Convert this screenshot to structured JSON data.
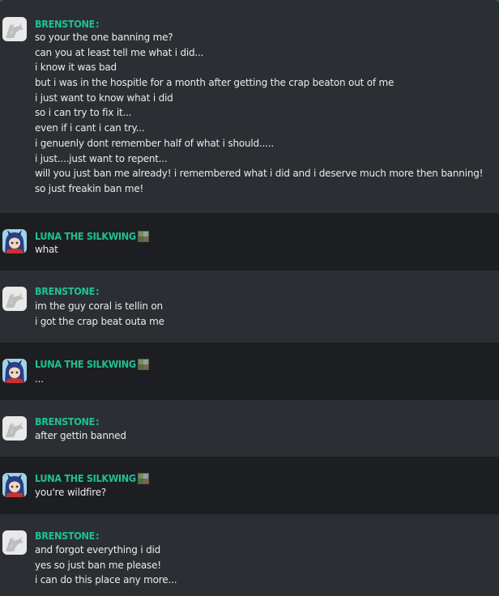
{
  "messages": [
    {
      "author": "BRENSTONE",
      "colon": ":",
      "lines": [
        "so your the one banning me?",
        "can you at least tell me what i did...",
        "i know it was bad",
        "but i was in the hospitle for a month after getting the crap beaton out of me",
        "i just want to know what i did",
        "so i can try to fix it...",
        "even if i cant i can try...",
        "i genuenly dont remember half of what i should.....",
        "i just....just want to repent...",
        "will you just ban me already! i remembered what i did and i deserve much more then banning!",
        "so just freakin ban me!"
      ]
    },
    {
      "author": "LUNA THE SILKWING",
      "lines": [
        "what"
      ]
    },
    {
      "author": "BRENSTONE",
      "colon": ":",
      "lines": [
        "im the guy coral is tellin on",
        "i got the crap beat outa me"
      ]
    },
    {
      "author": "LUNA THE SILKWING",
      "lines": [
        "..."
      ]
    },
    {
      "author": "BRENSTONE",
      "colon": ":",
      "lines": [
        "after gettin banned"
      ]
    },
    {
      "author": "LUNA THE SILKWING",
      "lines": [
        "you're wildfire?"
      ]
    },
    {
      "author": "BRENSTONE",
      "colon": ":",
      "lines": [
        "and forgot everything i did",
        "yes so just ban me please!",
        "i can do this place any more..."
      ]
    }
  ],
  "colors": {
    "username": "#1fc191",
    "text": "#ebebeb",
    "row_light": "#2b2e32",
    "row_dark": "#1c1e22",
    "top_border": "#2e5d4e"
  },
  "icons": {
    "brenstone_avatar": "default-dragon-silhouette-icon",
    "luna_avatar": "anime-character-avatar",
    "luna_badge": "small-pixel-badge-icon"
  }
}
